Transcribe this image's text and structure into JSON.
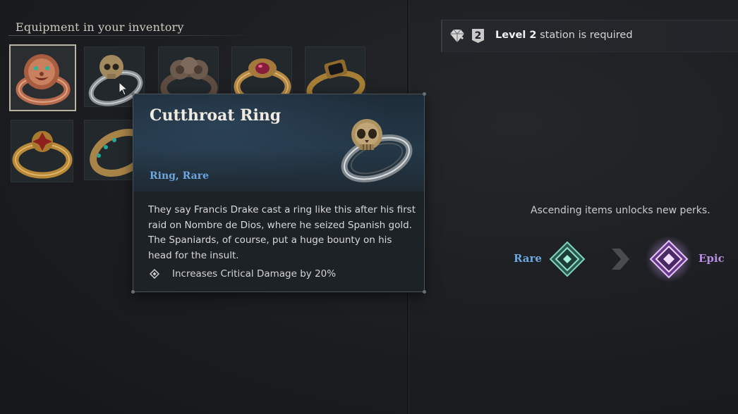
{
  "inventory": {
    "title": "Equipment in your inventory",
    "items": [
      {
        "name": "lion-ring",
        "color": "#c87a5a"
      },
      {
        "name": "skull-ring",
        "color": "#aab0b4"
      },
      {
        "name": "serpent-ring",
        "color": "#6d5a4e"
      },
      {
        "name": "ruby-ring",
        "color": "#c59a52"
      },
      {
        "name": "onyx-ring",
        "color": "#b28a3e"
      },
      {
        "name": "cross-ring",
        "color": "#c7943e"
      },
      {
        "name": "emerald-band-ring",
        "color": "#b98f4a"
      }
    ]
  },
  "tooltip": {
    "title": "Cutthroat Ring",
    "type": "Ring, Rare",
    "description": "They say Francis Drake cast a ring like this after his first raid on Nombre de Dios, where he seized Spanish gold. The Spaniards, of course, put a huge bounty on his head for the insult.",
    "perk": "Increases Critical Damage by 20%",
    "perk_icon": "diamond-bullet-icon"
  },
  "station": {
    "level_badge": "2",
    "level_label": "Level 2",
    "required_text": " station is required",
    "icon": "gem-icon"
  },
  "ascension": {
    "text": "Ascending items unlocks new perks.",
    "from_label": "Rare",
    "to_label": "Epic",
    "from_color": "#6fc7b0",
    "to_color": "#c89ae8"
  }
}
